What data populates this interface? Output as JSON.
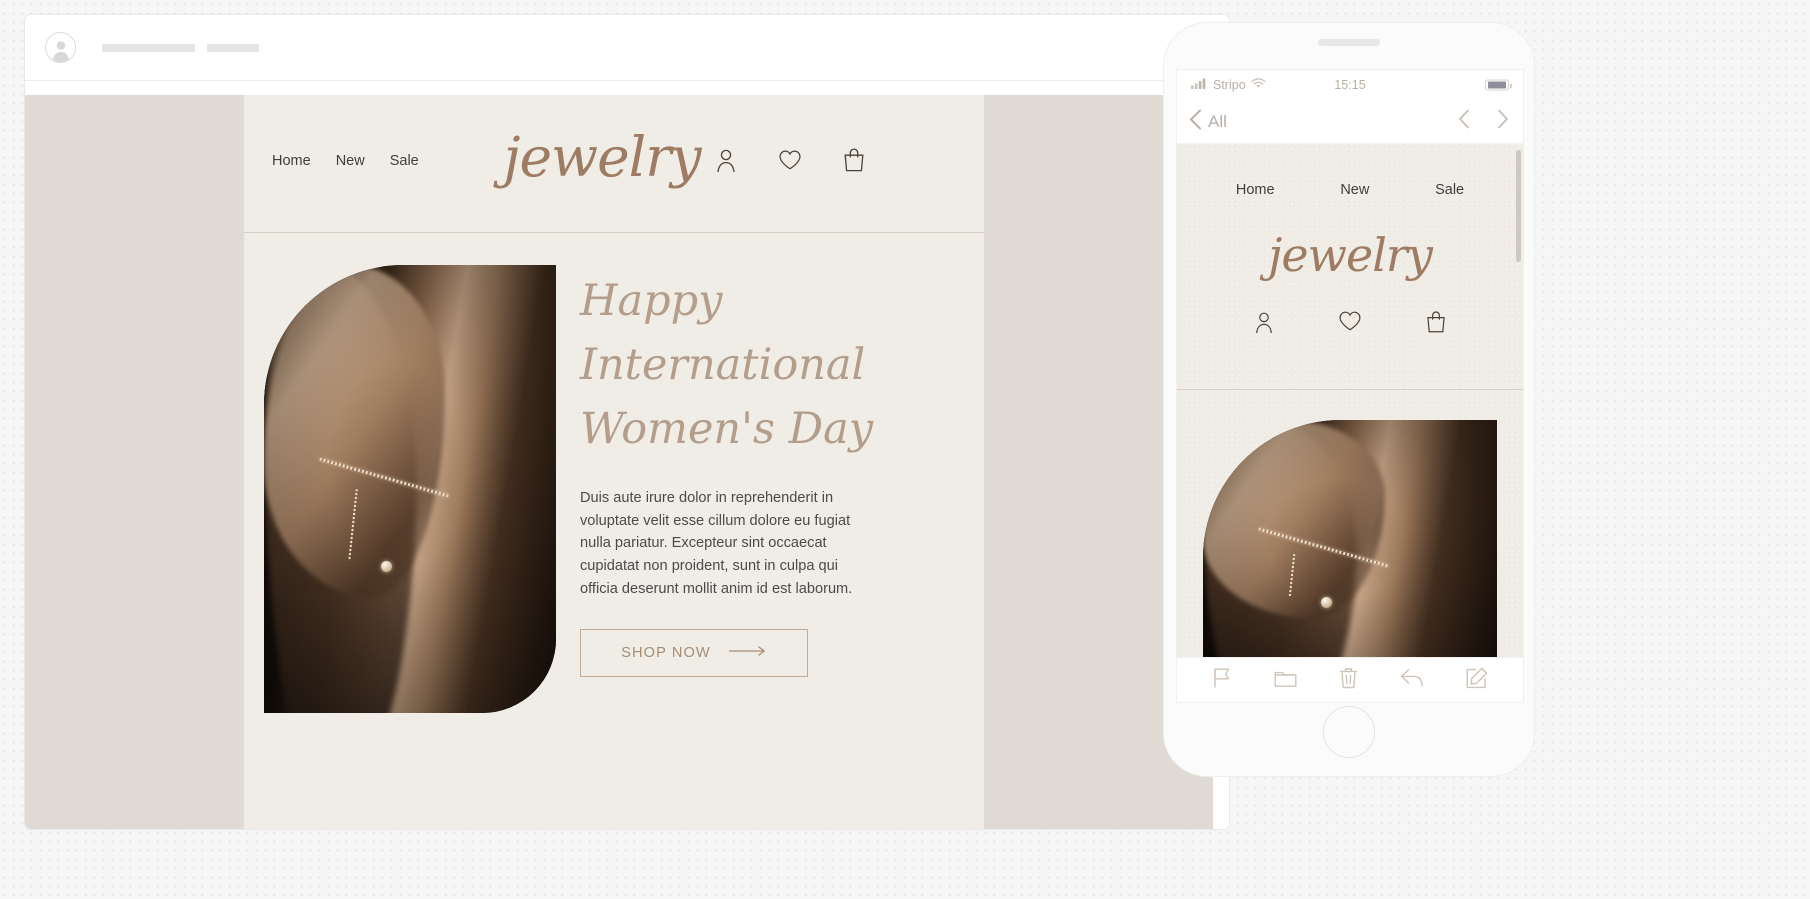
{
  "desktop": {
    "toolbar": {
      "avatar_icon": "user-avatar-icon",
      "placeholder_bars": 2
    },
    "email": {
      "nav": [
        {
          "label": "Home"
        },
        {
          "label": "New"
        },
        {
          "label": "Sale"
        }
      ],
      "logo": "jewelry",
      "header_icons": [
        {
          "name": "account-icon"
        },
        {
          "name": "wishlist-heart-icon"
        },
        {
          "name": "shopping-bag-icon"
        }
      ],
      "hero": {
        "heading_lines": [
          "Happy",
          "International",
          "Women's Day"
        ],
        "paragraph": "Duis aute irure dolor in reprehenderit in voluptate velit esse cillum dolore eu fugiat nulla pariatur. Excepteur sint occaecat cupidatat non proident, sunt in culpa qui officia deserunt mollit anim id est laborum.",
        "cta_label": "SHOP NOW",
        "cta_arrow_icon": "arrow-right-icon",
        "image_alt": "woman-hand-with-jewelry-photo"
      }
    },
    "colors": {
      "paper": "#f0ece6",
      "stage": "#e0dad4",
      "logo": "#9e7c63",
      "heading": "#b39e8b",
      "body_text": "#4b4b4b",
      "cta_border": "#c4ab93",
      "cta_text": "#a68d74",
      "divider": "#d8cfc4"
    }
  },
  "mobile": {
    "status_bar": {
      "carrier": "Stripo",
      "signal_icon": "cellular-signal-icon",
      "wifi_icon": "wifi-icon",
      "time": "15:15",
      "battery_icon": "battery-icon"
    },
    "mail_navbar": {
      "back_icon": "chevron-left-icon",
      "back_label": "All",
      "prev_icon": "chevron-left-icon",
      "next_icon": "chevron-right-icon"
    },
    "email": {
      "nav": [
        {
          "label": "Home"
        },
        {
          "label": "New"
        },
        {
          "label": "Sale"
        }
      ],
      "logo": "jewelry",
      "header_icons": [
        {
          "name": "account-icon"
        },
        {
          "name": "wishlist-heart-icon"
        },
        {
          "name": "shopping-bag-icon"
        }
      ],
      "hero_image_alt": "woman-hand-with-jewelry-photo"
    },
    "toolbar": [
      {
        "name": "flag-icon"
      },
      {
        "name": "folder-icon"
      },
      {
        "name": "trash-icon"
      },
      {
        "name": "reply-icon"
      },
      {
        "name": "compose-icon"
      }
    ],
    "home_button": "home-button"
  }
}
